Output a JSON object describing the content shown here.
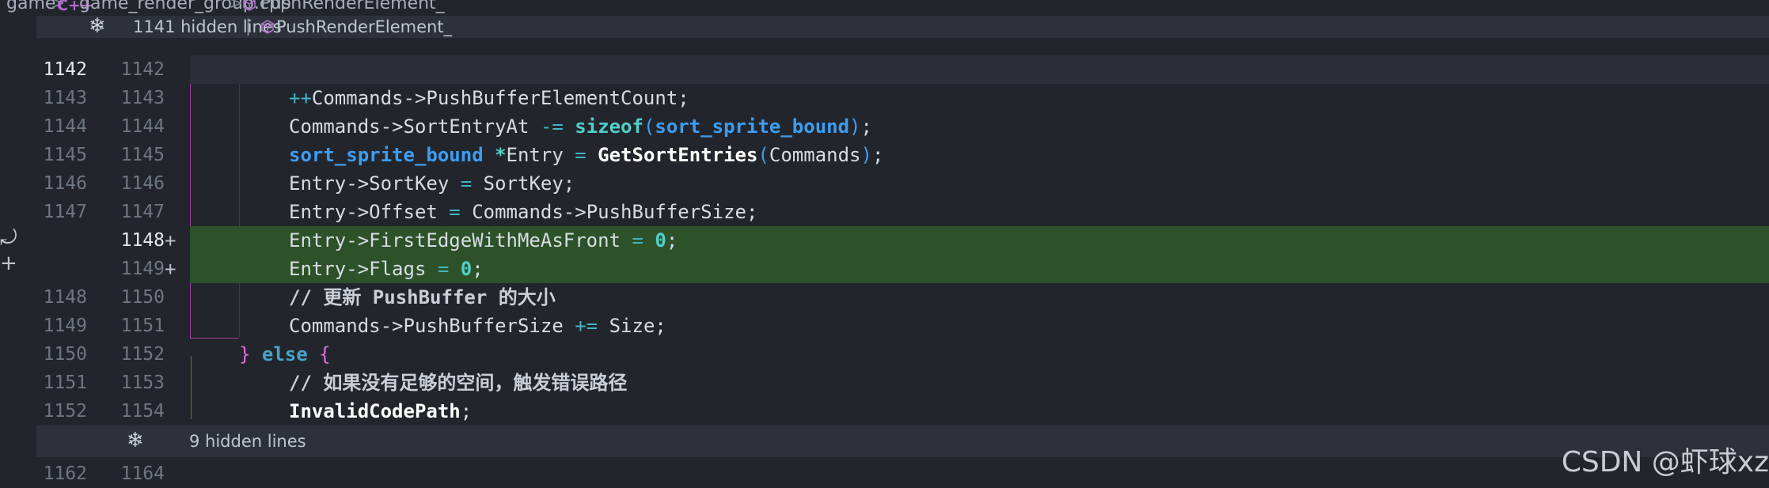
{
  "breadcrumb": {
    "folder": "game",
    "sep": ">",
    "file_icon": "cpp-file-icon",
    "file_icon_text": "C++",
    "file": "game_render_group.cpp",
    "symbol_icon": "cube-icon",
    "symbol": "PushRenderElement_"
  },
  "fold_top": {
    "text": "1141 hidden lines",
    "divider": "|",
    "symbol": "PushRenderElement_",
    "icon": "expand-icon"
  },
  "fold_bottom": {
    "text": "9 hidden lines",
    "icon": "expand-icon"
  },
  "rows": [
    {
      "old": "1142",
      "new": "1142",
      "plus": ""
    },
    {
      "old": "1143",
      "new": "1143",
      "plus": ""
    },
    {
      "old": "1144",
      "new": "1144",
      "plus": ""
    },
    {
      "old": "1145",
      "new": "1145",
      "plus": ""
    },
    {
      "old": "1146",
      "new": "1146",
      "plus": ""
    },
    {
      "old": "1147",
      "new": "1147",
      "plus": ""
    },
    {
      "old": "",
      "new": "1148",
      "plus": "+"
    },
    {
      "old": "",
      "new": "1149",
      "plus": "+"
    },
    {
      "old": "1148",
      "new": "1150",
      "plus": ""
    },
    {
      "old": "1149",
      "new": "1151",
      "plus": ""
    },
    {
      "old": "1150",
      "new": "1152",
      "plus": ""
    },
    {
      "old": "1151",
      "new": "1153",
      "plus": ""
    },
    {
      "old": "1152",
      "new": "1154",
      "plus": ""
    }
  ],
  "last_row": {
    "old": "1162",
    "new": "1164"
  },
  "code": {
    "l1_op": "++",
    "l1_text": "Commands->PushBufferElementCount;",
    "l2_a": "Commands->SortEntryAt ",
    "l2_op": "-=",
    "l2_kw": "sizeof",
    "l2_p1": "(",
    "l2_type": "sort_sprite_bound",
    "l2_p2": ")",
    "l2_end": ";",
    "l3_type": "sort_sprite_bound",
    "l3_star": "*",
    "l3_a": "Entry ",
    "l3_eq": "=",
    "l3_fn": "GetSortEntries",
    "l3_p1": "(",
    "l3_arg": "Commands",
    "l3_p2": ")",
    "l3_end": ";",
    "l4_a": "Entry->SortKey ",
    "l4_eq": "=",
    "l4_b": " SortKey;",
    "l5_a": "Entry->Offset ",
    "l5_eq": "=",
    "l5_b": " Commands->PushBufferSize;",
    "l6_a": "Entry->FirstEdgeWithMeAsFront ",
    "l6_eq": "=",
    "l6_num": "0",
    "l6_end": ";",
    "l7_a": "Entry->Flags ",
    "l7_eq": "=",
    "l7_num": "0",
    "l7_end": ";",
    "l8_comment": "// 更新 PushBuffer 的大小",
    "l9_a": "Commands->PushBufferSize ",
    "l9_op": "+=",
    "l9_b": " Size;",
    "l10_brace": "}",
    "l10_kw": "else",
    "l10_brace2": "{",
    "l11_comment": "// 如果没有足够的空间，触发错误路径",
    "l12_fn": "InvalidCodePath",
    "l12_end": ";"
  },
  "side_actions": {
    "revert_glyph": "⤾",
    "add_glyph": "+"
  },
  "watermark": "CSDN @虾球xz",
  "colors": {
    "background": "#22262c",
    "added_line": "#2d5229",
    "fold_bar": "#2d323a",
    "scope_guide": "#9f3aa0"
  }
}
